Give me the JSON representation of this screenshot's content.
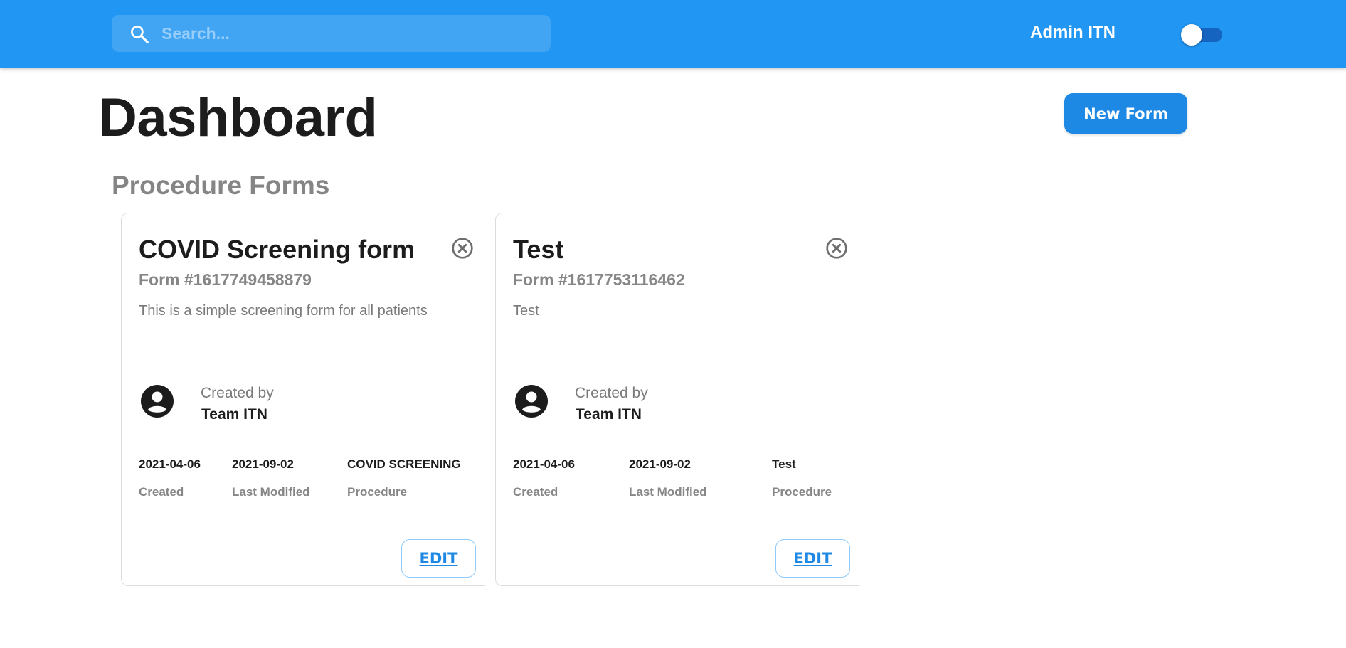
{
  "appbar": {
    "search": {
      "placeholder": "Search..."
    },
    "user_name": "Admin ITN",
    "theme_toggle": {
      "on": false
    }
  },
  "page": {
    "title": "Dashboard",
    "new_form_label": "New Form",
    "section_title": "Procedure Forms"
  },
  "colors": {
    "appbar": "#2196f3",
    "primary_button": "#1e88e5",
    "heading": "#1c1c1c",
    "muted": "#868686"
  },
  "cards": [
    {
      "title": "COVID Screening form",
      "number": "Form #1617749458879",
      "description": "This is a simple screening form for all patients",
      "created_by_caption": "Created by",
      "created_by": "Team ITN",
      "created": "2021-04-06",
      "last_modified": "2021-09-02",
      "procedure": "COVID SCREENING",
      "created_label": "Created",
      "last_modified_label": "Last Modified",
      "procedure_label": "Procedure",
      "edit_label": "EDIT"
    },
    {
      "title": "Test",
      "number": "Form #1617753116462",
      "description": "Test",
      "created_by_caption": "Created by",
      "created_by": "Team ITN",
      "created": "2021-04-06",
      "last_modified": "2021-09-02",
      "procedure": "Test",
      "created_label": "Created",
      "last_modified_label": "Last Modified",
      "procedure_label": "Procedure",
      "edit_label": "EDIT"
    }
  ],
  "icons": {
    "search": "search-icon",
    "close": "close-circle-icon",
    "creator": "account-circle-icon"
  }
}
